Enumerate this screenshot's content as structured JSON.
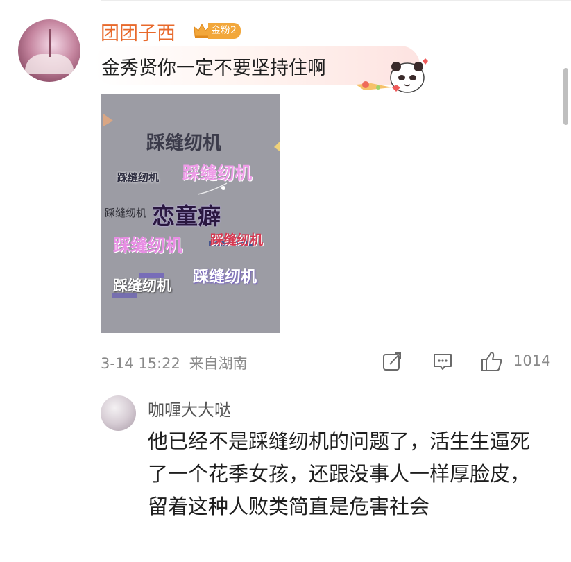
{
  "comment": {
    "username": "团团子西",
    "badge_label": "金粉2",
    "text": "金秀贤你一定不要坚持住啊",
    "timestamp": "3-14 15:22",
    "location": "来自湖南",
    "like_count": "1014",
    "image": {
      "words": [
        {
          "text": "踩缝纫机",
          "color": "#3b3b4a"
        },
        {
          "text": "踩缝纫机",
          "color": "#2d2d40"
        },
        {
          "text": "踩缝纫机",
          "color": "#ee9ce8"
        },
        {
          "text": "踩缝纫机",
          "color": "#2c2c34"
        },
        {
          "text": "恋童癖",
          "color": "#2a1840"
        },
        {
          "text": "踩缝纫机",
          "color": "#e88ee4"
        },
        {
          "text": "踩缝纫机",
          "color": "#d63a52"
        },
        {
          "text": "踩缝纫机",
          "color": "#ffffff"
        },
        {
          "text": "踩缝纫机",
          "color": "#ffffff"
        }
      ]
    }
  },
  "reply": {
    "username": "咖喱大大哒",
    "text": "他已经不是踩缝纫机的问题了，活生生逼死了一个花季女孩，还跟没事人一样厚脸皮，留着这种人败类简直是危害社会"
  },
  "colors": {
    "username": "#e8692b",
    "badge": "#f2a73b",
    "meta": "#8a8a8a"
  }
}
